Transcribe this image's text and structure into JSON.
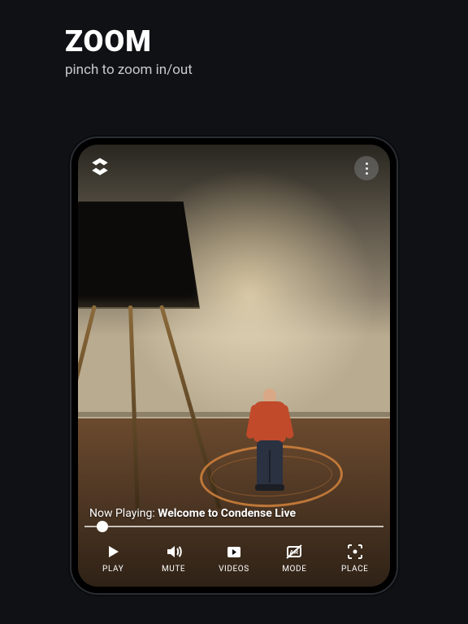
{
  "heading": {
    "title": "ZOOM",
    "subtitle": "pinch to zoom in/out"
  },
  "player": {
    "now_playing_prefix": "Now Playing: ",
    "now_playing_title": "Welcome to Condense Live",
    "progress_percent": 6
  },
  "toolbar": {
    "play": "PLAY",
    "mute": "MUTE",
    "videos": "VIDEOS",
    "mode": "MODE",
    "place": "PLACE"
  }
}
